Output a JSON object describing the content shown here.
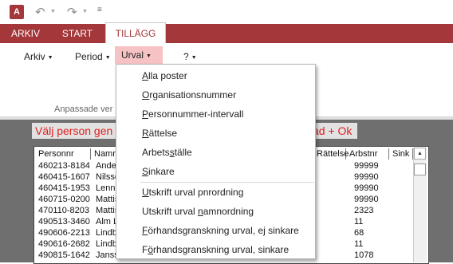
{
  "quick_access": {
    "app_logo": "A",
    "undo_icon": "undo-icon",
    "redo_icon": "redo-icon",
    "customize": "≡"
  },
  "tabs": [
    "ARKIV",
    "START",
    "TILLÄGG"
  ],
  "ribbon": {
    "menus": [
      "Arkiv",
      "Period",
      "Urval",
      "?"
    ],
    "group_label": "Anpassade ver"
  },
  "form": {
    "instruction": "Välj person gen",
    "instruction_tail": "ad + Ok"
  },
  "list": {
    "headers": {
      "nr": "Personnr",
      "name": "Namn",
      "rattelse": "Rättelse",
      "arbst": "Arbstnr",
      "sink": "Sink"
    },
    "rows": [
      {
        "nr": "460213-8184",
        "name": "Ander",
        "arb": "99999"
      },
      {
        "nr": "460415-1607",
        "name": "Nilsso",
        "arb": "99990"
      },
      {
        "nr": "460415-1953",
        "name": "Lenna",
        "arb": "99990"
      },
      {
        "nr": "460715-0200",
        "name": "Mattis",
        "arb": "99990"
      },
      {
        "nr": "470110-8203",
        "name": "Mattis",
        "arb": "2323"
      },
      {
        "nr": "490513-3460",
        "name": "Alm Li",
        "arb": "11"
      },
      {
        "nr": "490606-2213",
        "name": "Lindb",
        "arb": "68"
      },
      {
        "nr": "490616-2682",
        "name": "Lindb",
        "arb": "11"
      },
      {
        "nr": "490815-1642",
        "name": "Janss",
        "arb": "1078"
      }
    ]
  },
  "dropdown": {
    "items": [
      {
        "pre": "",
        "u": "A",
        "post": "lla poster"
      },
      {
        "pre": "",
        "u": "O",
        "post": "rganisationsnummer"
      },
      {
        "pre": "",
        "u": "P",
        "post": "ersonnummer-intervall"
      },
      {
        "pre": "",
        "u": "R",
        "post": "ättelse"
      },
      {
        "pre": "Arbets",
        "u": "s",
        "post": "tälle"
      },
      {
        "pre": "",
        "u": "S",
        "post": "inkare"
      },
      {
        "pre": "",
        "u": "U",
        "post": "tskrift urval pnrordning"
      },
      {
        "pre": "Utskrift urval ",
        "u": "n",
        "post": "amnordning"
      },
      {
        "pre": "",
        "u": "F",
        "post": "örhandsgranskning urval, ej sinkare"
      },
      {
        "pre": "F",
        "u": "ö",
        "post": "rhandsgranskning urval, sinkare"
      }
    ]
  }
}
